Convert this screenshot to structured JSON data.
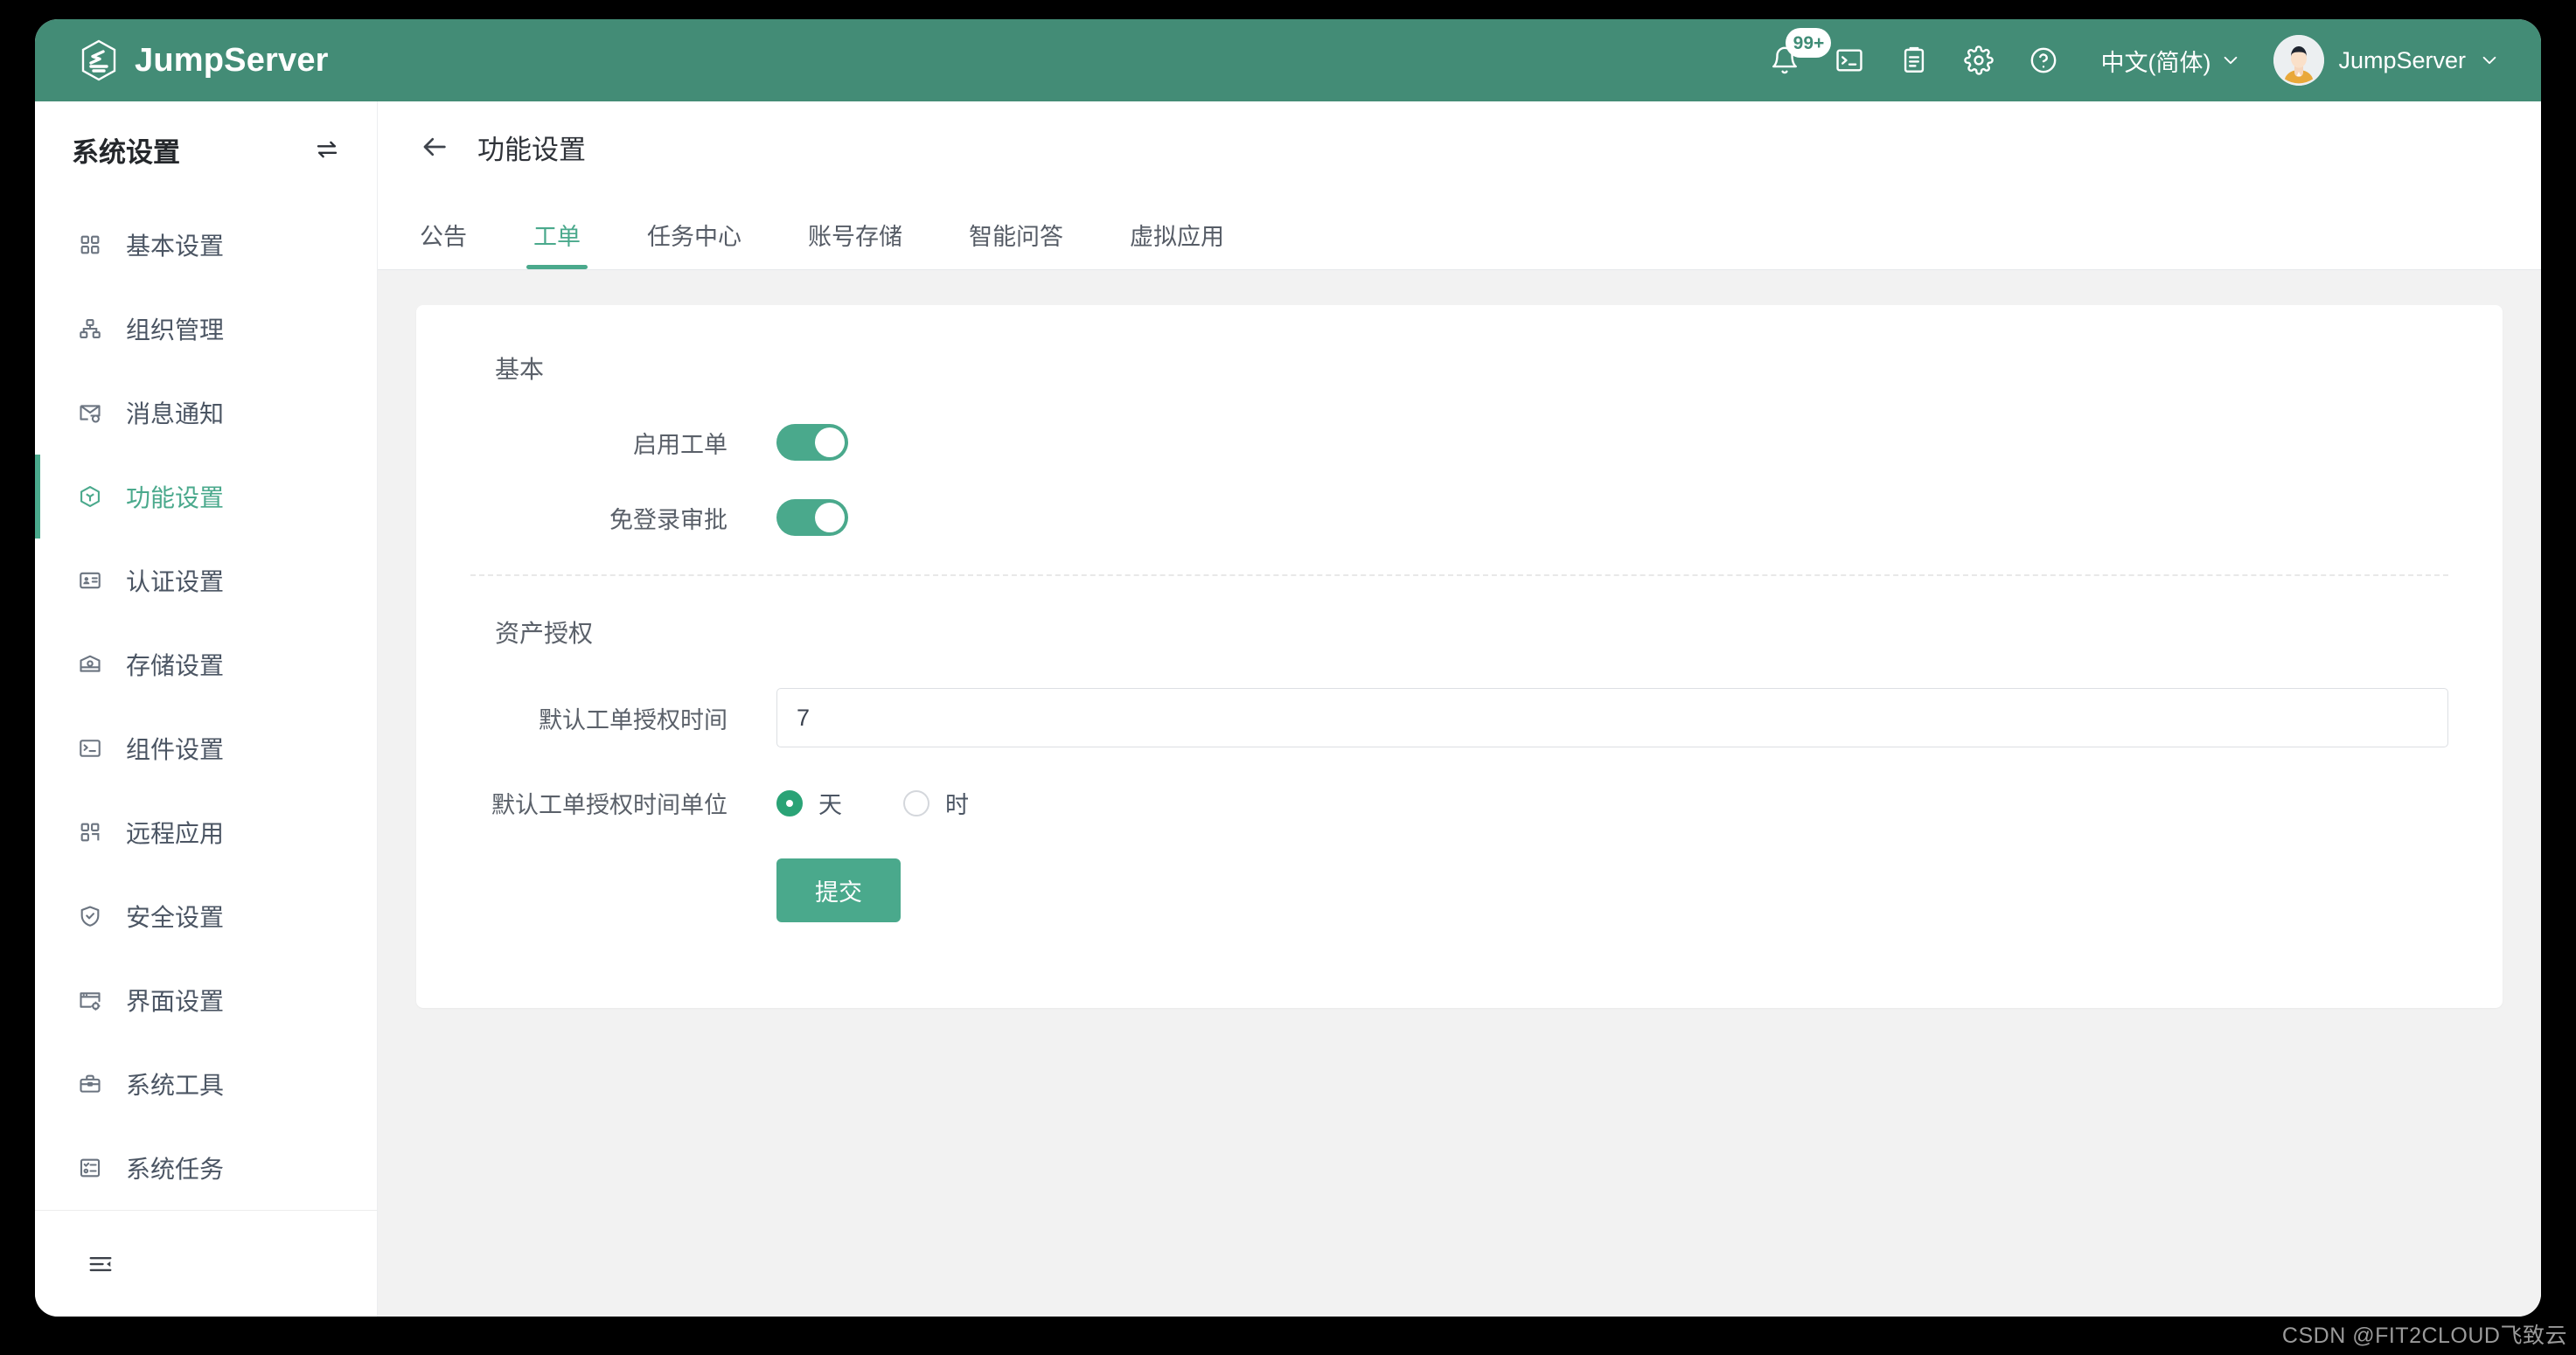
{
  "colors": {
    "brand_green": "#438c76",
    "accent_teal": "#4aa98c",
    "radio_checked": "#2aa376",
    "page_bg": "#f2f2f2",
    "text_primary": "#2e3238",
    "text_muted": "#5a6069"
  },
  "topbar": {
    "brand_name": "JumpServer",
    "logo_icon": "jumpserver-logo-icon",
    "icons": [
      {
        "name": "notification-bell-icon",
        "badge": "99+"
      },
      {
        "name": "terminal-icon",
        "badge": ""
      },
      {
        "name": "clipboard-icon",
        "badge": ""
      },
      {
        "name": "gear-icon",
        "badge": ""
      },
      {
        "name": "help-circle-icon",
        "badge": ""
      }
    ],
    "language": {
      "label": "中文(简体)",
      "caret": "chevron-down-icon"
    },
    "user": {
      "name": "JumpServer",
      "avatar": "user-avatar",
      "caret": "chevron-down-icon"
    }
  },
  "sidebar": {
    "title": "系统设置",
    "swap_icon": "exchange-arrows-icon",
    "collapse_icon": "collapse-sidebar-icon",
    "items": [
      {
        "label": "基本设置",
        "icon": "grid-squares-icon",
        "active": false
      },
      {
        "label": "组织管理",
        "icon": "org-tree-icon",
        "active": false
      },
      {
        "label": "消息通知",
        "icon": "mail-gear-icon",
        "active": false
      },
      {
        "label": "功能设置",
        "icon": "cube-icon",
        "active": true
      },
      {
        "label": "认证设置",
        "icon": "id-card-icon",
        "active": false
      },
      {
        "label": "存储设置",
        "icon": "storage-box-icon",
        "active": false
      },
      {
        "label": "组件设置",
        "icon": "terminal-box-icon",
        "active": false
      },
      {
        "label": "远程应用",
        "icon": "apps-grid-icon",
        "active": false
      },
      {
        "label": "安全设置",
        "icon": "shield-check-icon",
        "active": false
      },
      {
        "label": "界面设置",
        "icon": "window-gear-icon",
        "active": false
      },
      {
        "label": "系统工具",
        "icon": "toolbox-icon",
        "active": false
      },
      {
        "label": "系统任务",
        "icon": "task-list-icon",
        "active": false
      }
    ]
  },
  "page": {
    "back_icon": "back-arrow-icon",
    "title": "功能设置",
    "tabs": [
      {
        "label": "公告",
        "active": false
      },
      {
        "label": "工单",
        "active": true
      },
      {
        "label": "任务中心",
        "active": false
      },
      {
        "label": "账号存储",
        "active": false
      },
      {
        "label": "智能问答",
        "active": false
      },
      {
        "label": "虚拟应用",
        "active": false
      }
    ]
  },
  "form": {
    "basic_section_title": "基本",
    "enable_ticket": {
      "label": "启用工单",
      "on": true
    },
    "no_login_approval": {
      "label": "免登录审批",
      "on": true
    },
    "asset_section_title": "资产授权",
    "default_duration": {
      "label": "默认工单授权时间",
      "value": "7",
      "placeholder": ""
    },
    "duration_unit": {
      "label": "默认工单授权时间单位",
      "options": [
        {
          "label": "天",
          "checked": true
        },
        {
          "label": "时",
          "checked": false
        }
      ]
    },
    "submit_label": "提交"
  },
  "watermark": "CSDN @FIT2CLOUD飞致云"
}
